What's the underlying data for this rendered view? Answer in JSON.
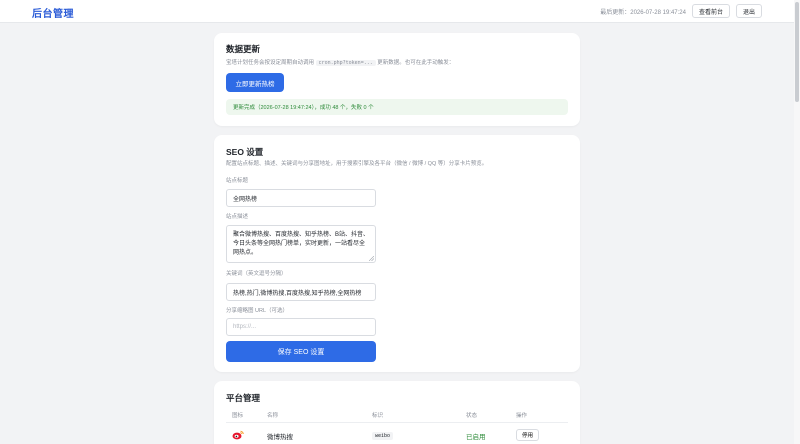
{
  "header": {
    "brand": "后台管理",
    "last_update": "最后更新：2026-07-28 19:47:24",
    "view_front_label": "查看前台",
    "logout_label": "退出"
  },
  "data_update": {
    "title": "数据更新",
    "desc_prefix": "宝塔计划任务会按设定周期自动调用",
    "desc_code": "cron.php?token=...",
    "desc_suffix": "更新数据。也可在此手动触发：",
    "refresh_button": "立即更新热榜",
    "result": "更新完成（2026-07-28 19:47:24），成功 48 个，失败 0 个"
  },
  "seo": {
    "title": "SEO 设置",
    "desc": "配置站点标题、描述、关键词与分享图地址，用于搜索引擎及各平台（微信 / 微博 / QQ 等）分享卡片预览。",
    "site_title_label": "站点标题",
    "site_title_value": "全网热榜",
    "site_desc_label": "站点描述",
    "site_desc_value": "聚合微博热搜、百度热搜、知乎热榜、B站、抖音、今日头条等全网热门榜单，实时更新，一站看尽全网热点。",
    "keywords_label": "关键词（英文逗号分隔）",
    "keywords_value": "热榜,热门,微博热搜,百度热搜,知乎热榜,全网热榜",
    "share_image_label": "分享缩略图 URL（可选）",
    "share_image_placeholder": "https://...",
    "save_button": "保存 SEO 设置"
  },
  "platforms": {
    "title": "平台管理",
    "columns": [
      "图标",
      "名称",
      "标识",
      "状态",
      "操作"
    ],
    "rows": [
      {
        "name": "微博热搜",
        "key": "weibo",
        "status": "已启用",
        "action": "停用"
      }
    ]
  },
  "colors": {
    "primary": "#2e6be6",
    "brand": "#2a5bd7",
    "success": "#2e8b3a",
    "weibo_red": "#e6162d"
  }
}
